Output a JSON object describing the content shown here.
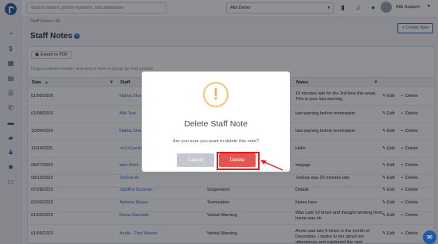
{
  "header": {
    "search_placeholder": "Search names, phone numbers, and addresses",
    "company": "Albi Demo",
    "company_caret": "▾",
    "user_name": "Albi Support",
    "user_caret": "▾"
  },
  "breadcrumb": "Staff Notes / All",
  "page_title": "Staff Notes",
  "create_button": "+ Create New",
  "export_button": "Export to PDF",
  "group_hint": "Drag a column header and drop it here to group by that column",
  "columns": {
    "date": "Date",
    "staff": "Staff",
    "notes": "Notes"
  },
  "rows": [
    {
      "date": "01/09/2026",
      "staff": "Nafisa Sha",
      "type": "",
      "note": "10 minutes late for the 3rd time this week. This is your last warning",
      "edit": "Edit",
      "del": "Delete"
    },
    {
      "date": "01/08/2026",
      "staff": "Albi Test",
      "type": "",
      "note": "last warning before termination",
      "edit": "Edit",
      "del": "Delete"
    },
    {
      "date": "12/04/2025",
      "staff": "Nafisa Sha",
      "type": "",
      "note": "last warning before termination",
      "edit": "Edit",
      "del": "Delete"
    },
    {
      "date": "11/24/2025",
      "staff": "<h1>Cacilo",
      "type": "",
      "note": "Hello",
      "edit": "Edit",
      "del": "Delete"
    },
    {
      "date": "08/27/2025",
      "staff": "alan thom",
      "type": "",
      "note": "wegsgs",
      "edit": "Edit",
      "del": "Delete"
    },
    {
      "date": "08/15/2023",
      "staff": "Joshua Ar",
      "type": "",
      "note": "Joshua was 20 minutes late",
      "edit": "Edit",
      "del": "Delete"
    },
    {
      "date": "07/28/2023",
      "staff": "Jabdhul Guzman",
      "type": "Suspension",
      "note": "Details",
      "edit": "Edit",
      "del": "Delete"
    },
    {
      "date": "02/06/2023",
      "staff": "Adriana Reyes",
      "type": "Termination",
      "note": "Notes here",
      "edit": "Edit",
      "del": "Delete"
    },
    {
      "date": "01/06/2023",
      "staff": "Maria Stahulak",
      "type": "Verbal Warning",
      "note": "Was Late 10 times and thought working from home was ok.",
      "edit": "Edit",
      "del": "Delete"
    },
    {
      "date": "01/05/2023",
      "staff": "Annie - Test Woods",
      "type": "Verbal Warning",
      "note": "Annie was late 5 times in the month of December, I spoke to her about her attendance and explained the next",
      "edit": "Edit",
      "del": "Delete"
    }
  ],
  "modal": {
    "title": "Delete Staff Note",
    "message": "Are you sure you want to delete this note?",
    "cancel": "Cancel",
    "delete": "Delete",
    "icon": "!"
  },
  "icons": {
    "sidebar": [
      "dashboard-icon",
      "money-icon",
      "calendar-icon",
      "map-icon",
      "list-icon",
      "phone-icon",
      "truck-icon",
      "folder-icon",
      "staff-icon",
      "settings-icon",
      "reports-icon"
    ],
    "header": [
      "chat-icon",
      "bell-icon",
      "help-icon"
    ]
  },
  "colors": {
    "accent": "#2a65d0",
    "danger": "#e55353",
    "warning": "#f0ad4e"
  }
}
